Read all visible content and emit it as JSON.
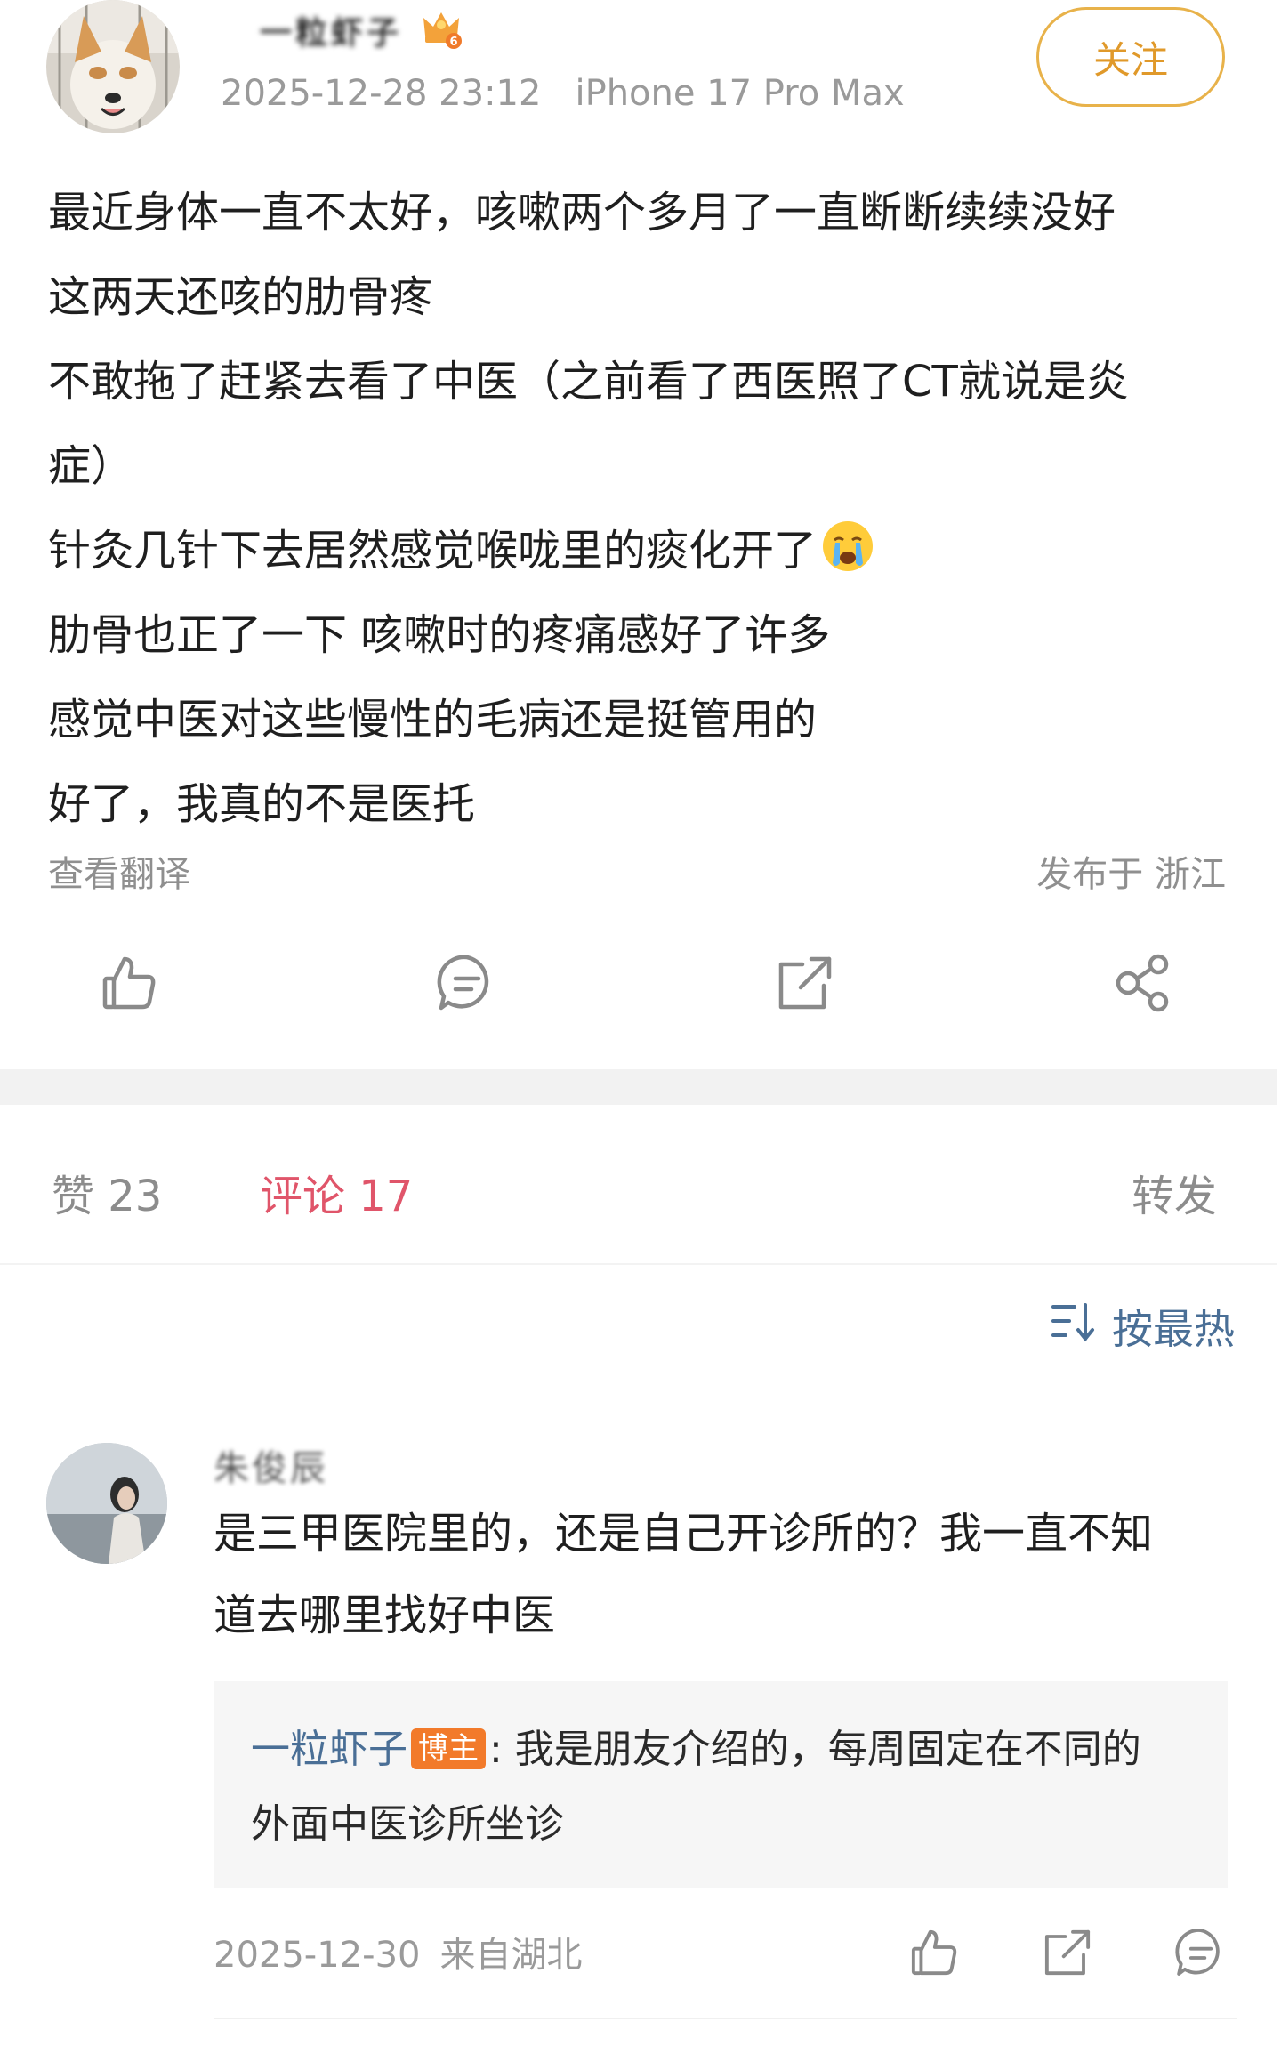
{
  "post": {
    "author": {
      "name": "一粒虾子",
      "badge_icon": "vip-crown-icon"
    },
    "timestamp": "2025-12-28 23:12",
    "device": "iPhone 17 Pro Max",
    "follow_label": "关注",
    "lines": [
      "最近身体一直不太好，咳嗽两个多月了一直断断续续没好",
      "这两天还咳的肋骨疼",
      "不敢拖了赶紧去看了中医（之前看了西医照了CT就说是炎",
      "症）",
      "针灸几针下去居然感觉喉咙里的痰化开了",
      "肋骨也正了一下 咳嗽时的疼痛感好了许多",
      "感觉中医对这些慢性的毛病还是挺管用的",
      "好了，我真的不是医托"
    ],
    "emoji": "crying-face-emoji",
    "translate_label": "查看翻译",
    "location": "发布于 浙江",
    "actions": [
      "like-icon",
      "comment-icon",
      "repost-icon",
      "share-icon"
    ]
  },
  "tabs": {
    "likes": "赞 23",
    "comments": "评论 17",
    "reposts": "转发"
  },
  "sort": {
    "icon": "sort-icon",
    "label": "按最热"
  },
  "comment": {
    "author": "朱俊辰",
    "text_line1": "是三甲医院里的，还是自己开诊所的？我一直不知",
    "text_line2": "道去哪里找好中医",
    "reply": {
      "author": "一粒虾子",
      "badge": "博主",
      "text_line1": ": 我是朋友介绍的，每周固定在不同的",
      "text_line2": "外面中医诊所坐诊"
    },
    "date": "2025-12-30",
    "location": "来自湖北"
  },
  "colors": {
    "accent_follow": "#e0992a",
    "accent_comment_tab": "#e0556a",
    "link_blue": "#4a6f96",
    "op_badge": "#f27a2a"
  }
}
